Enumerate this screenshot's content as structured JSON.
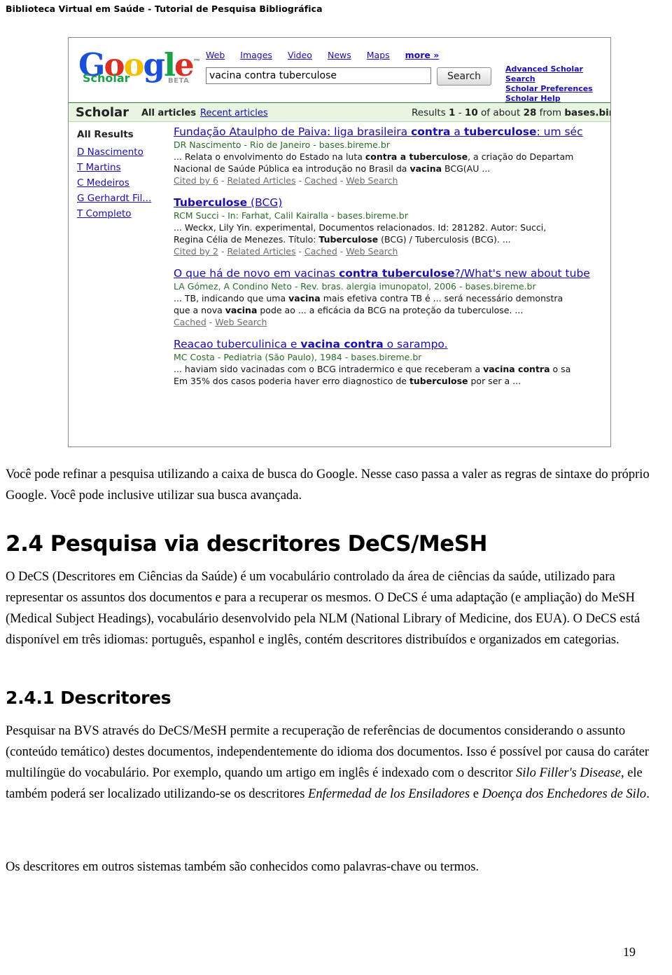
{
  "header": {
    "running_title": "Biblioteca Virtual em Saúde - Tutorial de Pesquisa Bibliográfica"
  },
  "figure": {
    "scholar": {
      "logo": {
        "letters": [
          "G",
          "o",
          "o",
          "g",
          "l",
          "e"
        ],
        "trademark": "™",
        "sub_label": "Scholar",
        "beta": "BETA"
      },
      "nav": [
        {
          "label": "Web"
        },
        {
          "label": "Images"
        },
        {
          "label": "Video"
        },
        {
          "label": "News"
        },
        {
          "label": "Maps"
        },
        {
          "label": "more »"
        }
      ],
      "search": {
        "value": "vacina contra tuberculose",
        "placeholder": "",
        "button_label": "Search"
      },
      "side_links": [
        "Advanced Scholar Search",
        "Scholar Preferences",
        "Scholar Help"
      ],
      "bar": {
        "scholar_word": "Scholar",
        "all_articles": "All articles",
        "recent_articles": "Recent articles",
        "results_prefix": "Results ",
        "results_range_start": "1",
        "results_dash": " - ",
        "results_range_end": "10",
        "results_mid": " of about ",
        "results_total": "28",
        "results_suffix": " from ",
        "results_source": "bases.bir"
      },
      "sidebar": {
        "heading": "All Results",
        "items": [
          "D Nascimento",
          "T Martins",
          "C Medeiros",
          "G Gerhardt Fil...",
          "T Completo"
        ]
      },
      "results": [
        {
          "title_pre": "Fundação Ataulpho de Paiva: liga brasileira ",
          "title_b1": "contra",
          "title_mid": " a ",
          "title_b2": "tuberculose",
          "title_post": ": um séc",
          "meta": "DR Nascimento - Rio de Janeiro - bases.bireme.br",
          "snippet_line1_pre": "... Relata o envolvimento do Estado na luta ",
          "snippet_line1_b": "contra a tuberculose",
          "snippet_line1_post": ", a criação do Departam",
          "snippet_line2_pre": "Nacional de Saúde Pública ea introdução no Brasil da ",
          "snippet_line2_b": "vacina",
          "snippet_line2_post": " BCG(AU ...",
          "actions": [
            "Cited by 6",
            "Related Articles",
            "Cached",
            "Web Search"
          ]
        },
        {
          "title_pre": "",
          "title_b1": "Tuberculose",
          "title_mid": " ",
          "title_b2": "",
          "title_post": "(BCG)",
          "meta": "RCM Succi - In: Farhat, Calil Kairalla - bases.bireme.br",
          "snippet_line1_pre": "... Weckx, Lily Yin. experimental, Documentos relacionados. Id: 281282. Autor: Succi,",
          "snippet_line1_b": "",
          "snippet_line1_post": "",
          "snippet_line2_pre": "Regina Célia de Menezes. Título: ",
          "snippet_line2_b": "Tuberculose",
          "snippet_line2_post": " (BCG) / Tuberculosis (BCG). ...",
          "actions": [
            "Cited by 2",
            "Related Articles",
            "Cached",
            "Web Search"
          ]
        },
        {
          "title_pre": "O que há de novo em vacinas ",
          "title_b1": "contra tuberculose",
          "title_mid": "",
          "title_b2": "",
          "title_post": "?/What's new about tube",
          "meta": "LA Gómez, A Condino Neto - Rev. bras. alergia imunopatol, 2006 - bases.bireme.br",
          "snippet_line1_pre": "... TB, indicando que uma ",
          "snippet_line1_b": "vacina",
          "snippet_line1_post": " mais efetiva contra TB é ... será necessário demonstra",
          "snippet_line2_pre": "que a nova ",
          "snippet_line2_b": "vacina",
          "snippet_line2_post": " pode ao ... a eficácia da BCG na proteção da tuberculose. ...",
          "actions": [
            "Cached",
            "Web Search"
          ]
        },
        {
          "title_pre": "Reacao tuberculinica e ",
          "title_b1": "vacina contra",
          "title_mid": "",
          "title_b2": "",
          "title_post": " o sarampo.",
          "meta": "MC Costa - Pediatria (São Paulo), 1984 - bases.bireme.br",
          "snippet_line1_pre": "... haviam sido vacinadas com o BCG intradermico e que receberam a ",
          "snippet_line1_b": "vacina contra",
          "snippet_line1_post": " o sa",
          "snippet_line2_pre": "Em 35% dos casos poderia haver erro diagnostico de ",
          "snippet_line2_b": "tuberculose",
          "snippet_line2_post": " por ser a ...",
          "actions": []
        }
      ]
    }
  },
  "document": {
    "intro_paragraph": "Você pode refinar a pesquisa utilizando a caixa de busca do Google. Nesse caso passa a valer as regras de sintaxe do próprio Google. Você pode inclusive utilizar sua busca avançada.",
    "section_heading": "2.4 Pesquisa via descritores DeCS/MeSH",
    "section_paragraph": "O DeCS (Descritores em Ciências da Saúde) é um vocabulário controlado da área de ciências da saúde, utilizado para representar os assuntos dos documentos e para a recuperar os mesmos. O DeCS é uma adaptação (e ampliação) do MeSH (Medical Subject Headings), vocabulário desenvolvido pela NLM (National Library of Medicine, dos EUA). O DeCS está disponível em três idiomas: português, espanhol e inglês, contém descritores distribuídos e organizados em categorias.",
    "subsection_heading": "2.4.1 Descritores",
    "subsection_paragraph_part1": "Pesquisar na BVS através do DeCS/MeSH permite a recuperação de referências de documentos considerando o assunto (conteúdo temático) destes documentos, independentemente do idioma dos documentos. Isso é possível por causa do caráter multilíngüe do vocabulário. Por exemplo, quando um artigo em inglês é indexado com o descritor ",
    "term_italic_1": "Silo Filler's Disease",
    "subsection_paragraph_part2": ", ele também poderá ser localizado utilizando-se os descritores ",
    "term_italic_2": "Enfermedad de los Ensiladores",
    "subsection_paragraph_part3": " e ",
    "term_italic_3": "Doença dos Enchedores de Silo",
    "subsection_paragraph_part4": ".",
    "closing_paragraph": "Os descritores em outros sistemas também são conhecidos como palavras-chave ou termos.",
    "page_number": "19"
  }
}
